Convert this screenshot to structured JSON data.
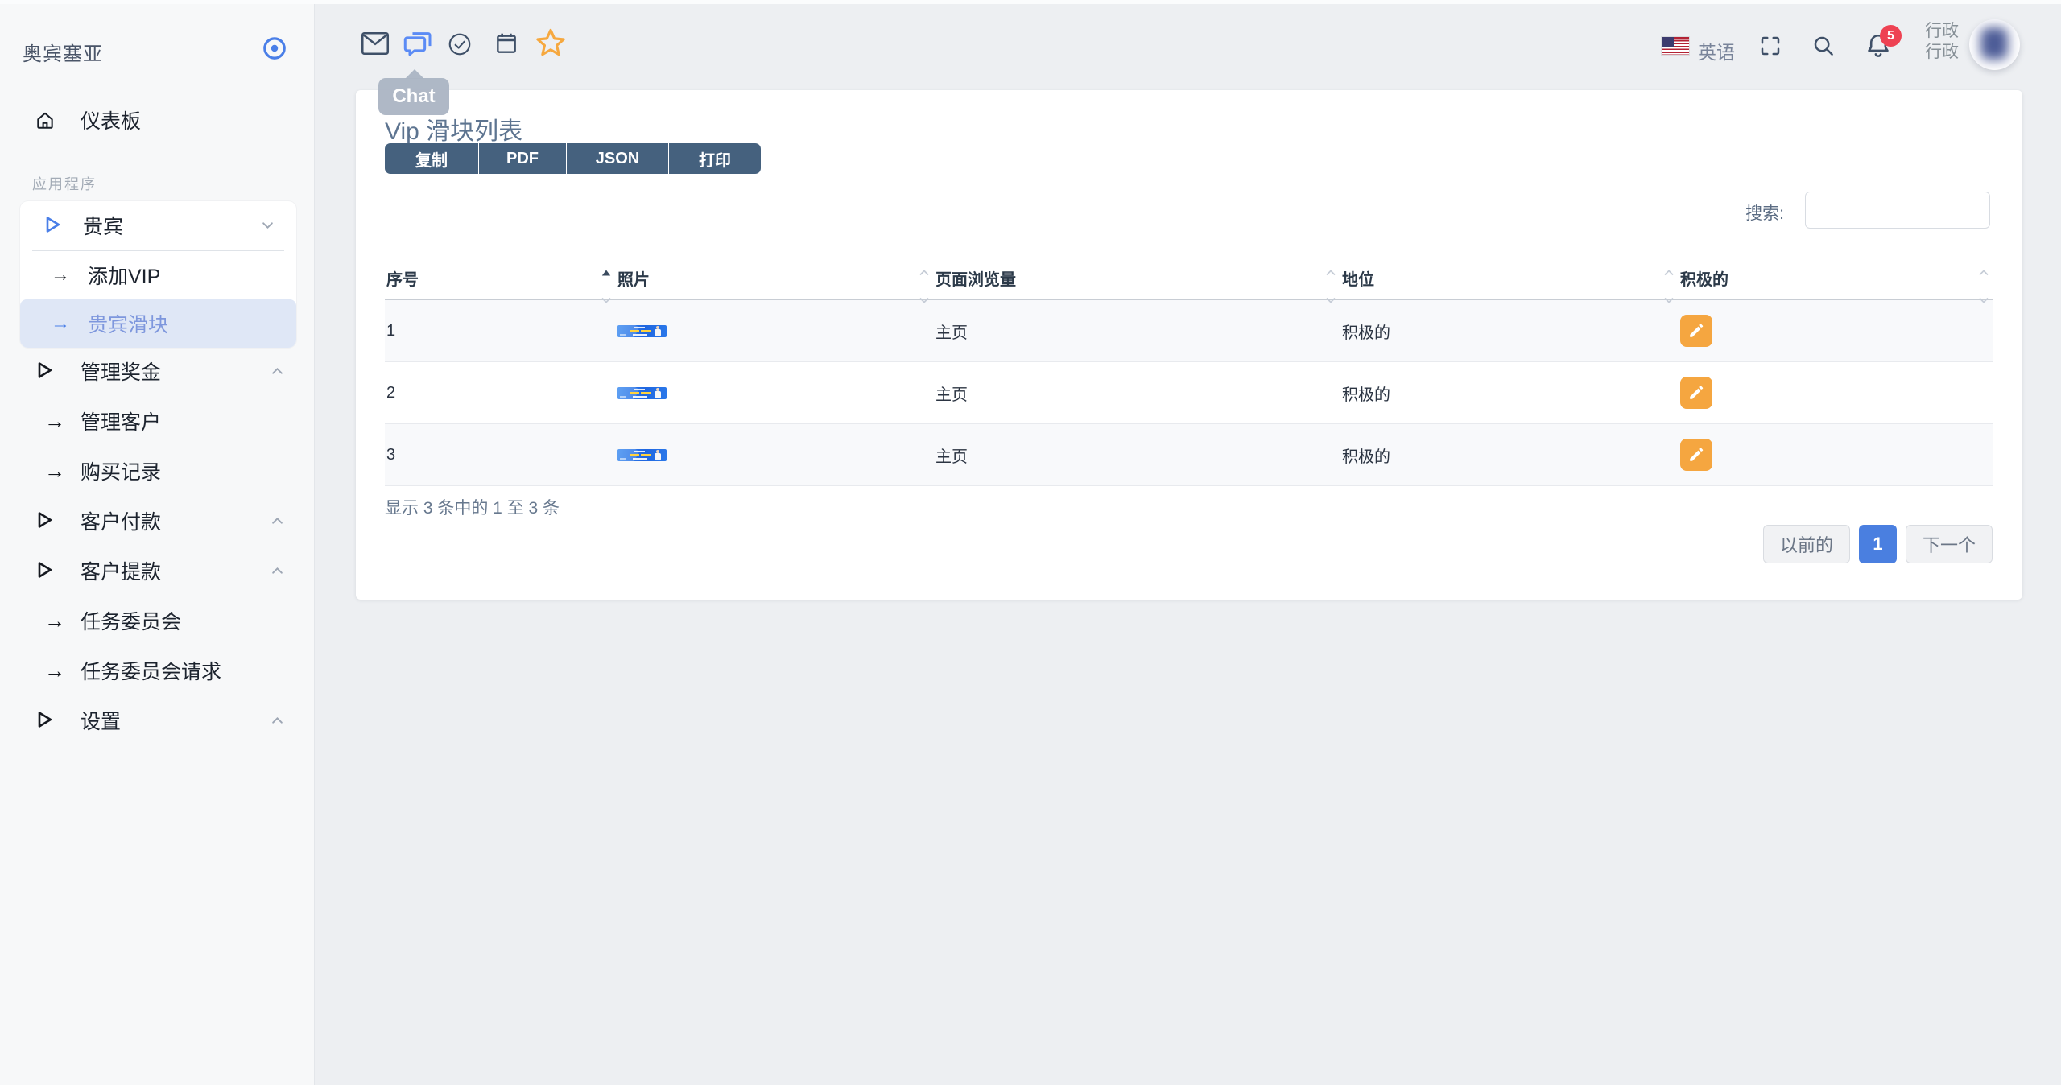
{
  "sidebar": {
    "brand": "奥宾塞亚",
    "dashboard": "仪表板",
    "section_label": "应用程序",
    "vip": {
      "label": "贵宾",
      "children": [
        {
          "label": "添加VIP"
        },
        {
          "label": "贵宾滑块",
          "active": true
        }
      ]
    },
    "items": [
      {
        "label": "管理奖金",
        "type": "group"
      },
      {
        "label": "管理客户",
        "type": "link"
      },
      {
        "label": "购买记录",
        "type": "link"
      },
      {
        "label": "客户付款",
        "type": "group"
      },
      {
        "label": "客户提款",
        "type": "group"
      },
      {
        "label": "任务委员会",
        "type": "link"
      },
      {
        "label": "任务委员会请求",
        "type": "link"
      },
      {
        "label": "设置",
        "type": "group"
      }
    ]
  },
  "topbar": {
    "tooltip": "Chat",
    "language": "英语",
    "notification_count": "5",
    "user_line1": "行政",
    "user_line2": "行政"
  },
  "main": {
    "title": "Vip 滑块列表",
    "export_buttons": [
      "复制",
      "PDF",
      "JSON",
      "打印"
    ],
    "search_label": "搜索:",
    "search_value": "",
    "table": {
      "headers": [
        "序号",
        "照片",
        "页面浏览量",
        "地位",
        "积极的"
      ],
      "sorted_column": "序号",
      "sort_direction": "asc",
      "rows": [
        {
          "serial": "1",
          "page_views": "主页",
          "status": "积极的"
        },
        {
          "serial": "2",
          "page_views": "主页",
          "status": "积极的"
        },
        {
          "serial": "3",
          "page_views": "主页",
          "status": "积极的"
        }
      ]
    },
    "footer_info": "显示 3 条中的 1 至 3 条",
    "pagination": {
      "previous": "以前的",
      "current": "1",
      "next": "下一个"
    }
  },
  "icons": {
    "arrow_right": "→"
  },
  "colors": {
    "accent_blue": "#4a7fe8",
    "export_button": "#45617e",
    "edit_orange": "#f5a640",
    "star_orange": "#f6a83f",
    "badge_red": "#ee4253",
    "active_item_bg": "#dfe7f6",
    "active_item_text": "#7e97dd",
    "page_bg": "#edeff2",
    "sidebar_bg": "#f7f8f9"
  }
}
